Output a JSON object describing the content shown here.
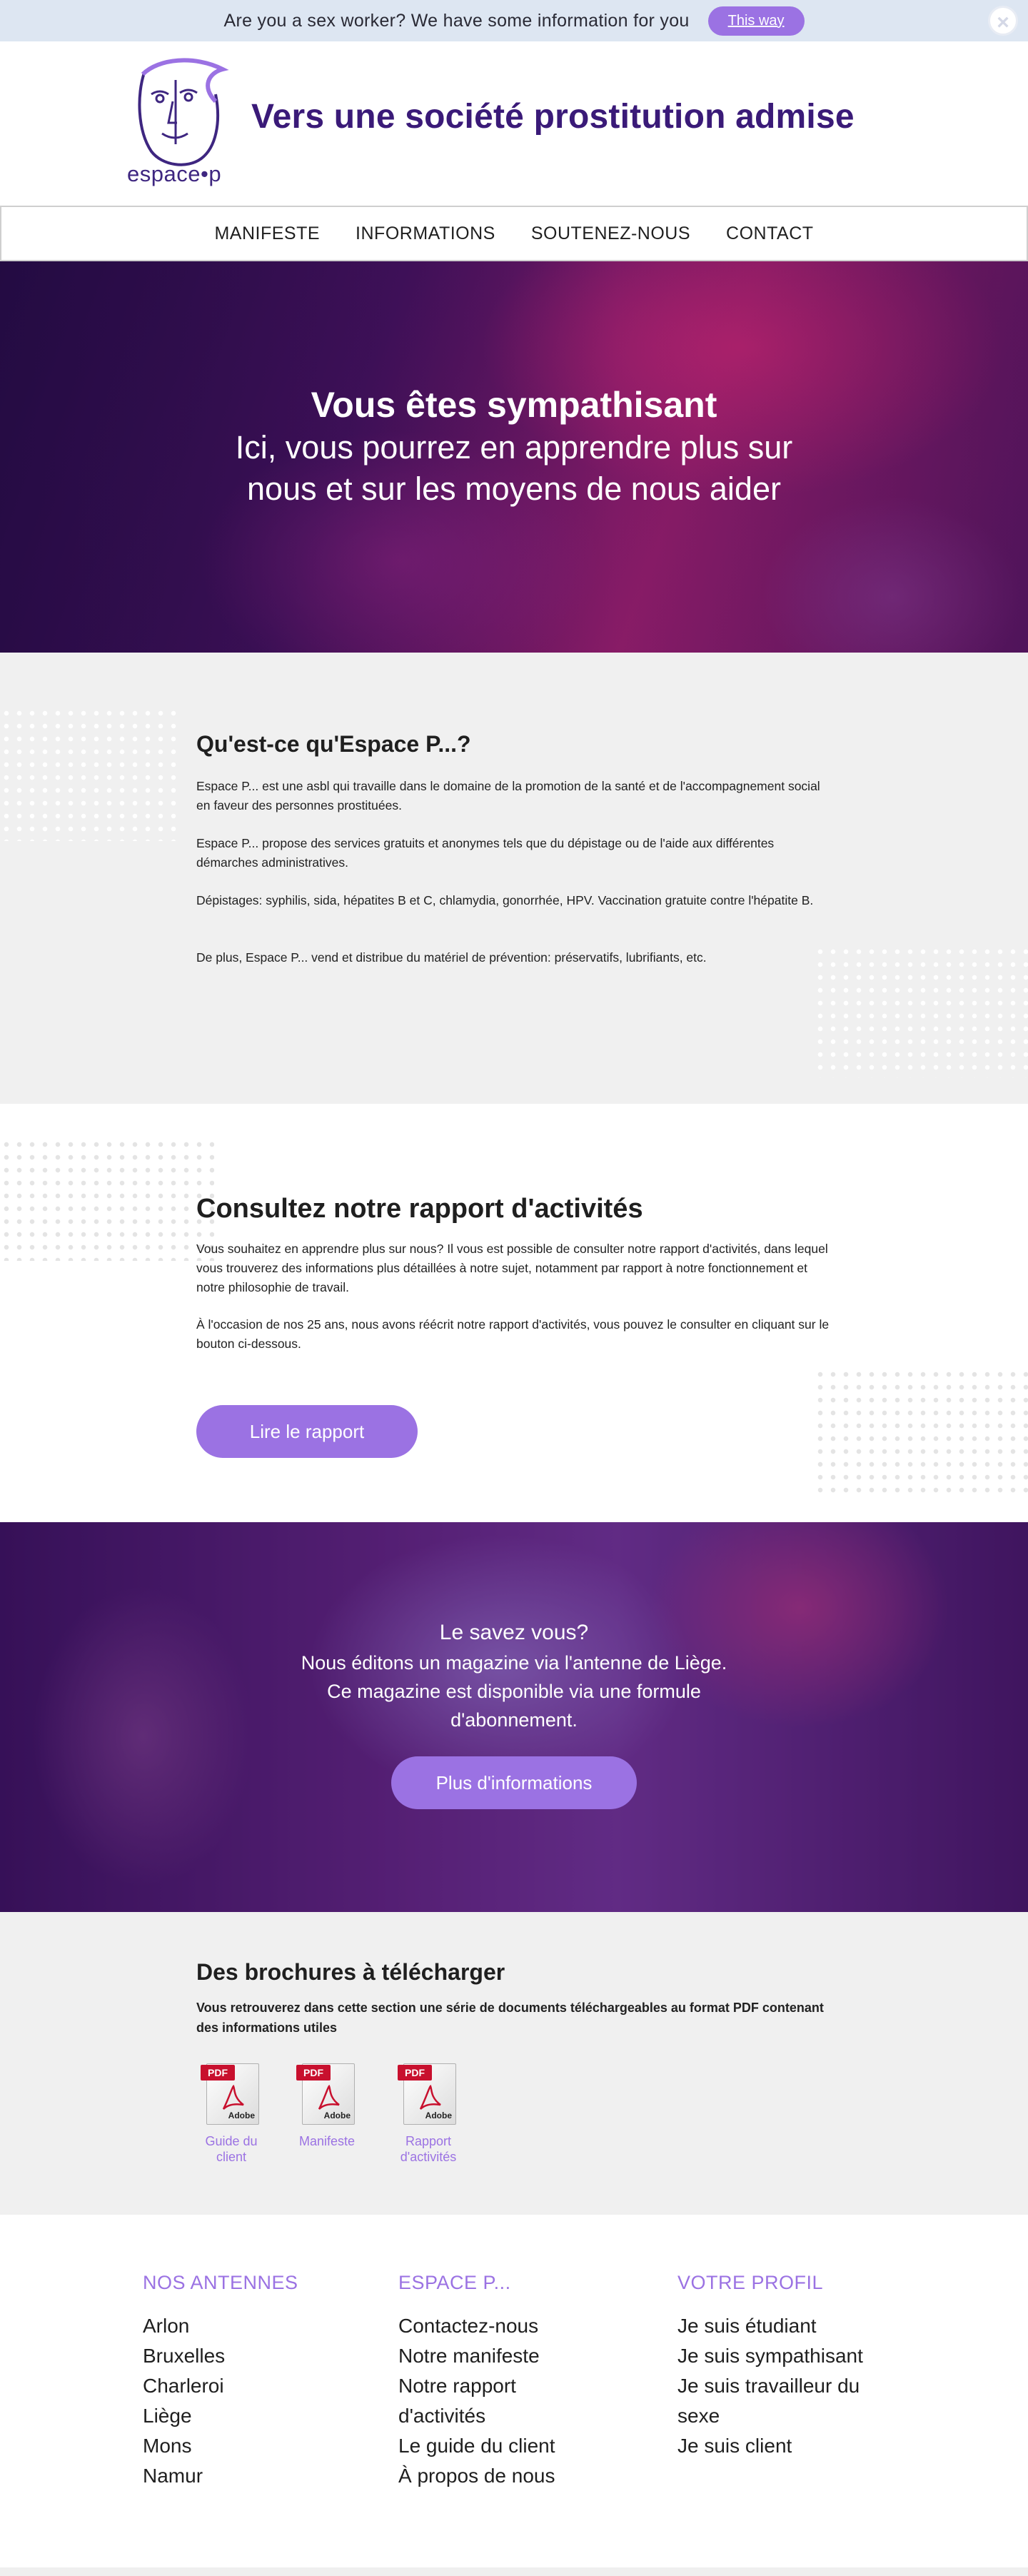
{
  "topbar": {
    "message": "Are you a sex worker? We have some information for you",
    "button_label": "This way",
    "close_icon": "close-icon"
  },
  "header": {
    "logo_text": "espace•p",
    "site_title": "Vers une société prostitution admise"
  },
  "nav": {
    "items": [
      "MANIFESTE",
      "INFORMATIONS",
      "SOUTENEZ-NOUS",
      "CONTACT"
    ]
  },
  "hero": {
    "title": "Vous êtes sympathisant",
    "subtitle": "Ici, vous pourrez en apprendre plus sur nous et sur les moyens de nous aider"
  },
  "about": {
    "title": "Qu'est-ce qu'Espace P...?",
    "paragraphs": [
      "Espace P... est une asbl qui travaille dans le domaine de la promotion de la santé et de l'accompagnement social en faveur des personnes prostituées.",
      "Espace P... propose des services gratuits et anonymes tels que du dépistage ou de l'aide aux différentes démarches administratives.",
      "Dépistages: syphilis, sida, hépatites B et C, chlamydia, gonorrhée, HPV. Vaccination gratuite contre l'hépatite B.",
      "De plus, Espace P... vend et distribue du matériel de prévention: préservatifs, lubrifiants, etc."
    ]
  },
  "report": {
    "title": "Consultez notre rapport d'activités",
    "paragraphs": [
      "Vous souhaitez en apprendre plus sur nous? Il vous est possible de consulter notre rapport d'activités, dans lequel vous trouverez des informations plus détaillées à notre sujet, notamment par rapport à notre fonctionnement et notre philosophie de travail.",
      "À l'occasion de nos 25 ans, nous avons réécrit notre rapport d'activités, vous pouvez le consulter en cliquant sur le bouton ci-dessous."
    ],
    "button_label": "Lire le rapport"
  },
  "magazine": {
    "title": "Le savez vous?",
    "lines": [
      "Nous éditons un magazine via l'antenne de Liège.",
      "Ce magazine est disponible via une formule",
      "d'abonnement."
    ],
    "button_label": "Plus d'informations"
  },
  "brochures": {
    "title": "Des brochures à télécharger",
    "description": "Vous retrouverez dans cette section une série de documents téléchargeables au format PDF contenant des informations utiles",
    "pdf_tag": "PDF",
    "adobe_text": "Adobe",
    "documents": [
      "Guide du client",
      "Manifeste",
      "Rapport d'activités"
    ]
  },
  "footer": {
    "columns": [
      {
        "heading": "NOS ANTENNES",
        "links": [
          "Arlon",
          "Bruxelles",
          "Charleroi",
          "Liège",
          "Mons",
          "Namur"
        ]
      },
      {
        "heading": "ESPACE P...",
        "links": [
          "Contactez-nous",
          "Notre manifeste",
          "Notre rapport d'activités",
          "Le guide du client",
          "À propos de nous"
        ]
      },
      {
        "heading": "VOTRE PROFIL",
        "links": [
          "Je suis étudiant",
          "Je suis sympathisant",
          "Je suis travailleur du sexe",
          "Je suis client"
        ]
      }
    ]
  },
  "colors": {
    "accent": "#9b72e3",
    "title_purple": "#3a1a78",
    "topbar_bg": "#dde6f2",
    "section_grey": "#f0f0f0"
  }
}
